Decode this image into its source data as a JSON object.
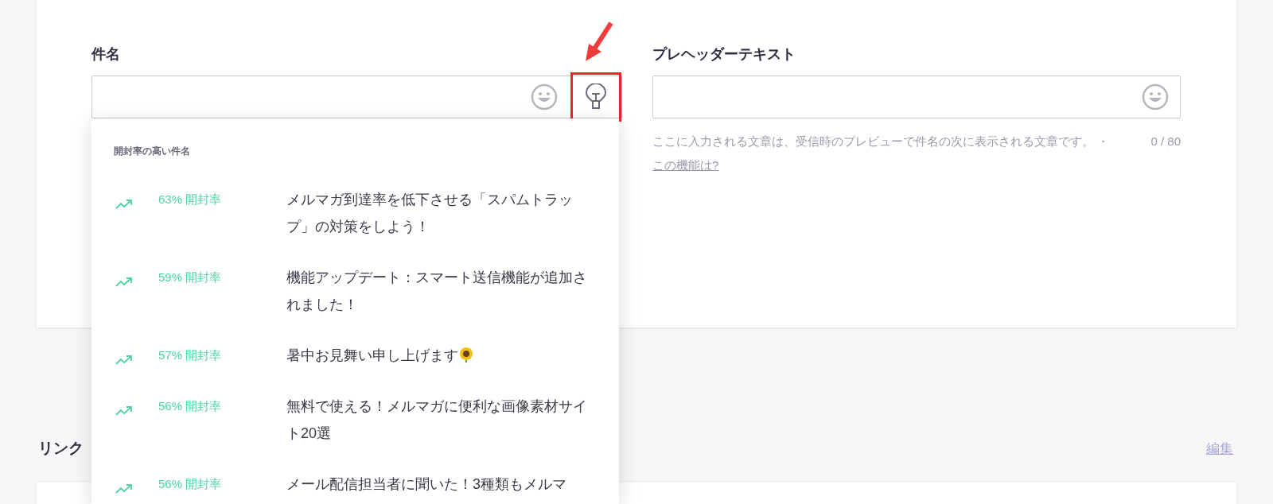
{
  "subject": {
    "label": "件名",
    "highlighted_button": true
  },
  "preheader": {
    "label": "プレヘッダーテキスト",
    "hint": "ここに入力される文章は、受信時のプレビューで件名の次に表示される文章です。",
    "separator": "・",
    "link": "この機能は?",
    "counter": "0 / 80"
  },
  "suggestions": {
    "title": "開封率の高い件名",
    "items": [
      {
        "rate": "63% 開封率",
        "subject": "メルマガ到達率を低下させる「スパムトラップ」の対策をしよう！"
      },
      {
        "rate": "59% 開封率",
        "subject": "機能アップデート：スマート送信機能が追加されました！"
      },
      {
        "rate": "57% 開封率",
        "subject": "暑中お見舞い申し上げます",
        "sunflower": true
      },
      {
        "rate": "56% 開封率",
        "subject": "無料で使える！メルマガに便利な画像素材サイト20選"
      },
      {
        "rate": "56% 開封率",
        "subject": "メール配信担当者に聞いた！3種類もメルマ"
      }
    ]
  },
  "links_section": {
    "title": "リンク",
    "edit_link": "編集"
  }
}
